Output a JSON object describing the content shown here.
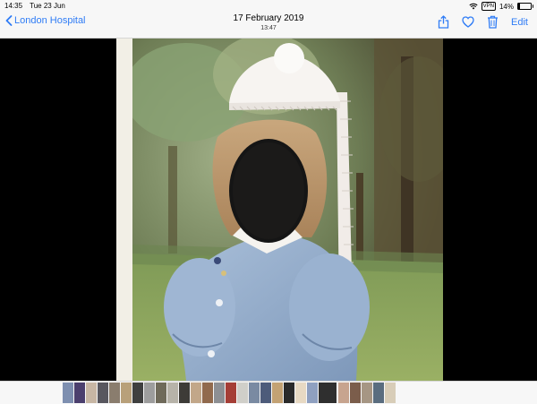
{
  "status_bar": {
    "time": "14:35",
    "date": "Tue 23 Jun",
    "vpn": "VPN",
    "battery_text": "14%",
    "battery_level": 0.14,
    "icons": [
      "wifi-icon",
      "vpn-badge",
      "battery-icon"
    ]
  },
  "nav": {
    "back_label": "London Hospital",
    "title": "17 February 2019",
    "subtitle": "13:47",
    "edit_label": "Edit",
    "icons": [
      "share-icon",
      "heart-icon",
      "trash-icon"
    ],
    "accent": "#2f7cf6"
  },
  "thumbnails": {
    "colors": [
      "#7e8fb0",
      "#4b3f6e",
      "#c7b6a4",
      "#58575f",
      "#8a7d6e",
      "#b8a07a",
      "#3f3f3f",
      "#9d9d9d",
      "#6f6a5a",
      "#b7b3a9",
      "#3d3b37",
      "#c2a789",
      "#916a4d",
      "#8d8f93",
      "#a53e36",
      "#d0cfc9",
      "#7a8aa2",
      "#4d5b7a",
      "#c3a274",
      "#2a2a2a",
      "#e7d9c3",
      "#8fa0c0",
      "#2f2f2f",
      "#c7a48f",
      "#7b5d4b",
      "#a69684",
      "#5a6d7f",
      "#d8cdb8"
    ],
    "selected_index": 22
  }
}
